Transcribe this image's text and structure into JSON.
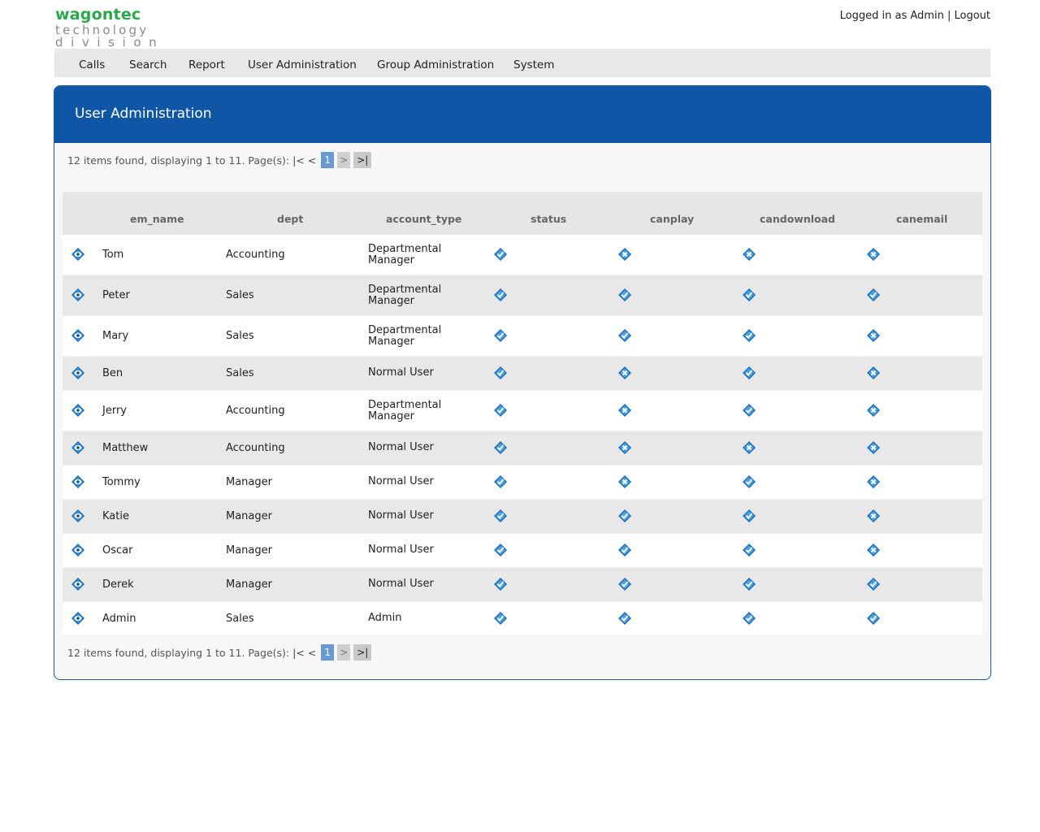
{
  "logo": {
    "main": "wagontec",
    "sub1": "technology",
    "sub2": "division"
  },
  "userbar": {
    "logged_in": "Logged in as Admin",
    "separator": "|",
    "logout": "Logout"
  },
  "nav": [
    {
      "label": "Calls"
    },
    {
      "label": "Search"
    },
    {
      "label": "Report"
    },
    {
      "label": "User Administration"
    },
    {
      "label": "Group Administration"
    },
    {
      "label": "System"
    }
  ],
  "panel": {
    "title": "User Administration"
  },
  "pager": {
    "summary": "12 items found, displaying 1 to 11. Page(s):",
    "first_prev": "|< <",
    "current": "1",
    "next": ">",
    "last": ">|"
  },
  "columns": [
    "em_name",
    "dept",
    "account_type",
    "status",
    "canplay",
    "candownload",
    "canemail"
  ],
  "rows": [
    {
      "em_name": "Tom",
      "dept": "Accounting",
      "account_type": "Departmental Manager",
      "status": "check",
      "canplay": "cross",
      "candownload": "cross",
      "canemail": "cross"
    },
    {
      "em_name": "Peter",
      "dept": "Sales",
      "account_type": "Departmental Manager",
      "status": "check",
      "canplay": "check",
      "candownload": "check",
      "canemail": "check"
    },
    {
      "em_name": "Mary",
      "dept": "Sales",
      "account_type": "Departmental Manager",
      "status": "check",
      "canplay": "check",
      "candownload": "check",
      "canemail": "cross"
    },
    {
      "em_name": "Ben",
      "dept": "Sales",
      "account_type": "Normal User",
      "status": "check",
      "canplay": "cross",
      "candownload": "check",
      "canemail": "cross"
    },
    {
      "em_name": "Jerry",
      "dept": "Accounting",
      "account_type": "Departmental Manager",
      "status": "check",
      "canplay": "cross",
      "candownload": "check",
      "canemail": "cross"
    },
    {
      "em_name": "Matthew",
      "dept": "Accounting",
      "account_type": "Normal User",
      "status": "check",
      "canplay": "cross",
      "candownload": "cross",
      "canemail": "cross"
    },
    {
      "em_name": "Tommy",
      "dept": "Manager",
      "account_type": "Normal User",
      "status": "check",
      "canplay": "cross",
      "candownload": "check",
      "canemail": "cross"
    },
    {
      "em_name": "Katie",
      "dept": "Manager",
      "account_type": "Normal User",
      "status": "check",
      "canplay": "check",
      "candownload": "check",
      "canemail": "cross"
    },
    {
      "em_name": "Oscar",
      "dept": "Manager",
      "account_type": "Normal User",
      "status": "check",
      "canplay": "check",
      "candownload": "check",
      "canemail": "cross"
    },
    {
      "em_name": "Derek",
      "dept": "Manager",
      "account_type": "Normal User",
      "status": "check",
      "canplay": "check",
      "candownload": "check",
      "canemail": "check"
    },
    {
      "em_name": "Admin",
      "dept": "Sales",
      "account_type": "Admin",
      "status": "check",
      "canplay": "check",
      "candownload": "check",
      "canemail": "check"
    }
  ],
  "colors": {
    "header_blue": "#0f57a6",
    "logo_green": "#2aa84a",
    "icon_blue": "#1b6fb8"
  }
}
